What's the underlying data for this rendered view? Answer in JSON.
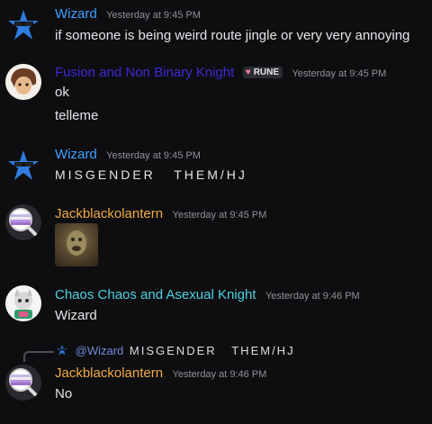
{
  "messages": [
    {
      "author": "Wizard",
      "author_color": "#3fa0ff",
      "avatar_icon": "wizard-star-sunglasses-icon",
      "timestamp": "Yesterday at 9:45 PM",
      "lines": [
        "if someone is being weird route jingle or very very annoying"
      ]
    },
    {
      "author": "Fusion and Non Binary Knight",
      "author_color": "#3b2bd6",
      "avatar_icon": "brown-hair-character-avatar",
      "badge": "RUNE",
      "timestamp": "Yesterday at 9:45 PM",
      "lines": [
        "ok",
        "telleme"
      ]
    },
    {
      "author": "Wizard",
      "author_color": "#3fa0ff",
      "avatar_icon": "wizard-star-sunglasses-icon",
      "timestamp": "Yesterday at 9:45 PM",
      "lines": [
        "MISGENDER   THEM/HJ"
      ]
    },
    {
      "author": "Jackblackolantern",
      "author_color": "#f0a94a",
      "avatar_icon": "magnifier-striped-flag-icon",
      "timestamp": "Yesterday at 9:45 PM",
      "attachment": "image"
    },
    {
      "author": "Chaos Chaos and Asexual Knight",
      "author_color": "#4fd1e0",
      "avatar_icon": "knight-character-avatar",
      "timestamp": "Yesterday at 9:46 PM",
      "lines": [
        "Wizard"
      ]
    },
    {
      "reply_mention": "@Wizard",
      "reply_text": "MISGENDER   THEM/HJ",
      "author": "Jackblackolantern",
      "author_color": "#f0a94a",
      "avatar_icon": "magnifier-striped-flag-icon",
      "timestamp": "Yesterday at 9:46 PM",
      "lines": [
        "No"
      ]
    }
  ]
}
